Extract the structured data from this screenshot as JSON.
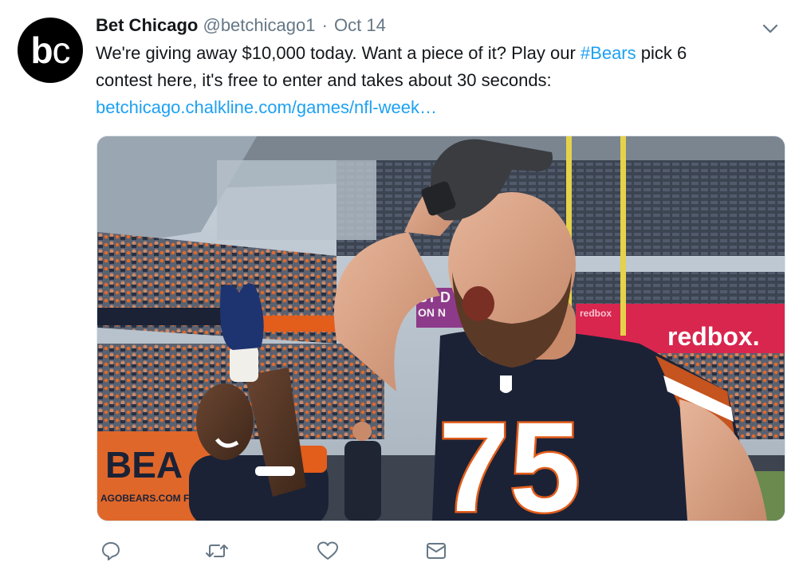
{
  "tweet": {
    "avatar_text_b": "b",
    "avatar_text_c": "c",
    "display_name": "Bet Chicago",
    "handle": "@betchicago1",
    "separator": "·",
    "date": "Oct 14",
    "text_line1_pre": "We're giving away $10,000 today. Want a piece of it? Play our ",
    "hashtag": "#Bears",
    "text_line1_post": " pick 6",
    "text_line2": "contest here, it's free to enter and takes about 30 seconds:",
    "link": "betchicago.chalkline.com/games/nfl-week…"
  },
  "media": {
    "jersey_number": "75",
    "banner_redbox": "redbox.",
    "banner_redbox_small": "redbox",
    "wall_bears": "BEA",
    "wall_url": "AGOBEARS.COM F",
    "ribbon_text": "ST D",
    "ribbon_text2": "ON N"
  },
  "icons": {
    "reply": "reply-icon",
    "retweet": "retweet-icon",
    "like": "heart-icon",
    "message": "envelope-icon",
    "caret": "chevron-down-icon"
  },
  "colors": {
    "link": "#1da1f2",
    "secondary_text": "#657786",
    "navy": "#1b2236",
    "orange": "#e35d1b"
  }
}
